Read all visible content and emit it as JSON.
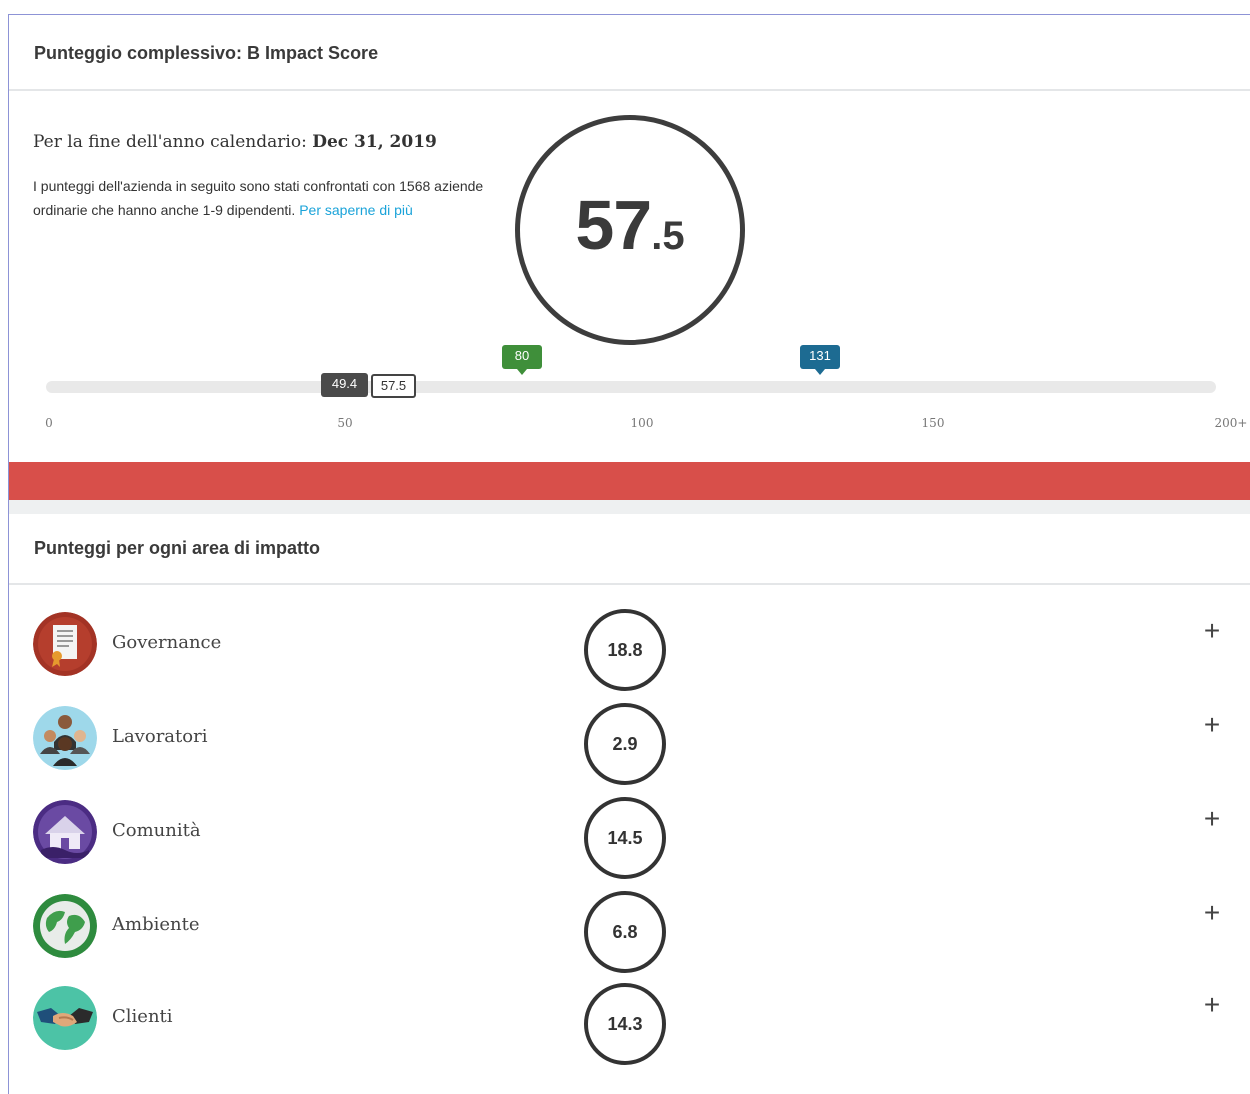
{
  "overall": {
    "header": "Punteggio complessivo: B Impact Score",
    "period_label": "Per la fine dell'anno calendario:",
    "period_date": "Dec 31, 2019",
    "description": "I punteggi dell'azienda in seguito sono stati confrontati con 1568 aziende ordinarie che hanno anche 1-9 dipendenti.",
    "learn_more_link": "Per saperne di più",
    "score_int": "57",
    "score_dec": ".5"
  },
  "scale": {
    "ticks": [
      "0",
      "50",
      "100",
      "150",
      "200+"
    ],
    "markers": {
      "median": "49.4",
      "company": "57.5",
      "certification": "80",
      "top": "131"
    },
    "colors": {
      "certification": "#3f8f3a",
      "top": "#1d6b92",
      "median": "#4a4a4a"
    }
  },
  "areas": {
    "header": "Punteggi per ogni area di impatto",
    "items": [
      {
        "label": "Governance",
        "score": "18.8",
        "icon": "certificate-document-icon"
      },
      {
        "label": "Lavoratori",
        "score": "2.9",
        "icon": "workers-group-icon"
      },
      {
        "label": "Comunità",
        "score": "14.5",
        "icon": "community-house-icon"
      },
      {
        "label": "Ambiente",
        "score": "6.8",
        "icon": "globe-environment-icon"
      },
      {
        "label": "Clienti",
        "score": "14.3",
        "icon": "handshake-icon"
      }
    ],
    "expand_symbol": "+"
  },
  "accent_colors": {
    "band": "#d84f4a",
    "link": "#1aa3d9"
  }
}
